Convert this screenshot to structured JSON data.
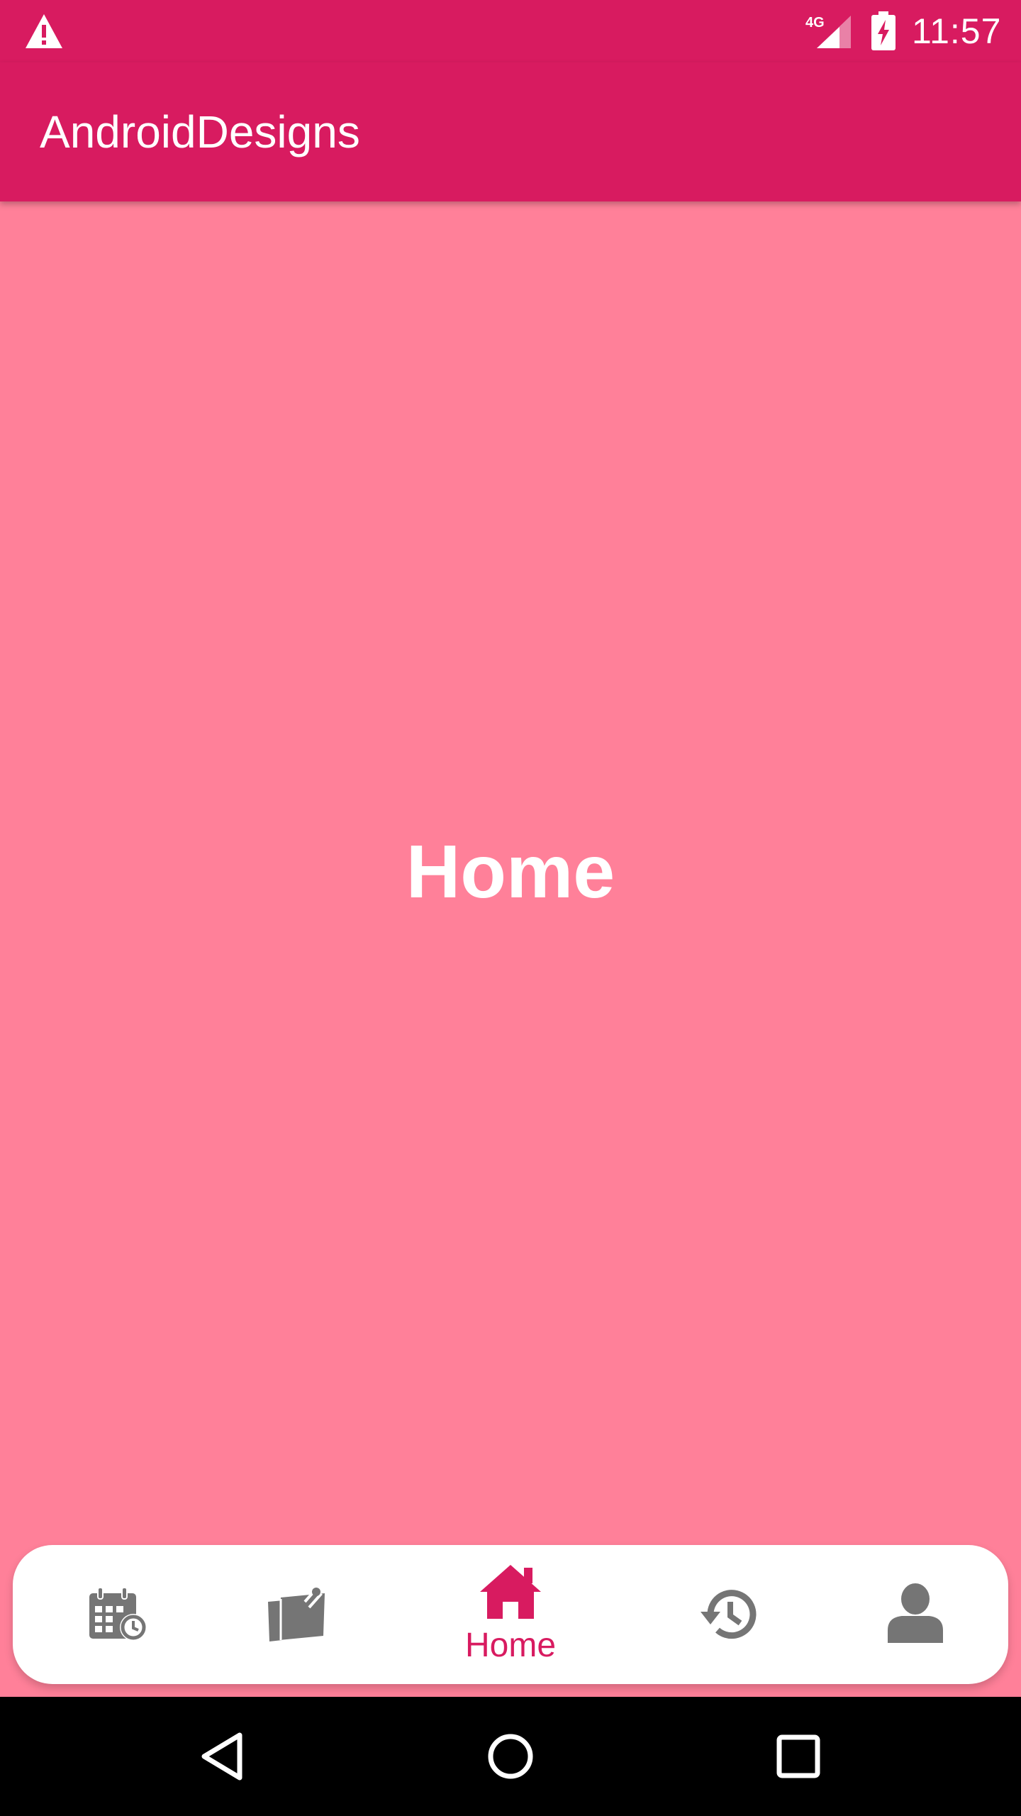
{
  "status_bar": {
    "time": "11:57",
    "network_type": "4G",
    "icons": [
      "warning-icon",
      "signal-icon",
      "battery-charging-icon"
    ]
  },
  "app_bar": {
    "title": "AndroidDesigns"
  },
  "content": {
    "heading": "Home"
  },
  "bottom_nav": {
    "selected_index": 2,
    "items": [
      {
        "icon": "calendar-clock-icon",
        "label": ""
      },
      {
        "icon": "notes-icon",
        "label": ""
      },
      {
        "icon": "home-icon",
        "label": "Home"
      },
      {
        "icon": "history-icon",
        "label": ""
      },
      {
        "icon": "person-icon",
        "label": ""
      }
    ]
  },
  "system_nav": {
    "icons": [
      "back-icon",
      "home-circle-icon",
      "recents-icon"
    ]
  },
  "colors": {
    "primary": "#D81B60",
    "background": "#FF8099",
    "nav_background": "#FFFFFF",
    "inactive_icon": "#757575",
    "active_icon": "#D81B60"
  }
}
